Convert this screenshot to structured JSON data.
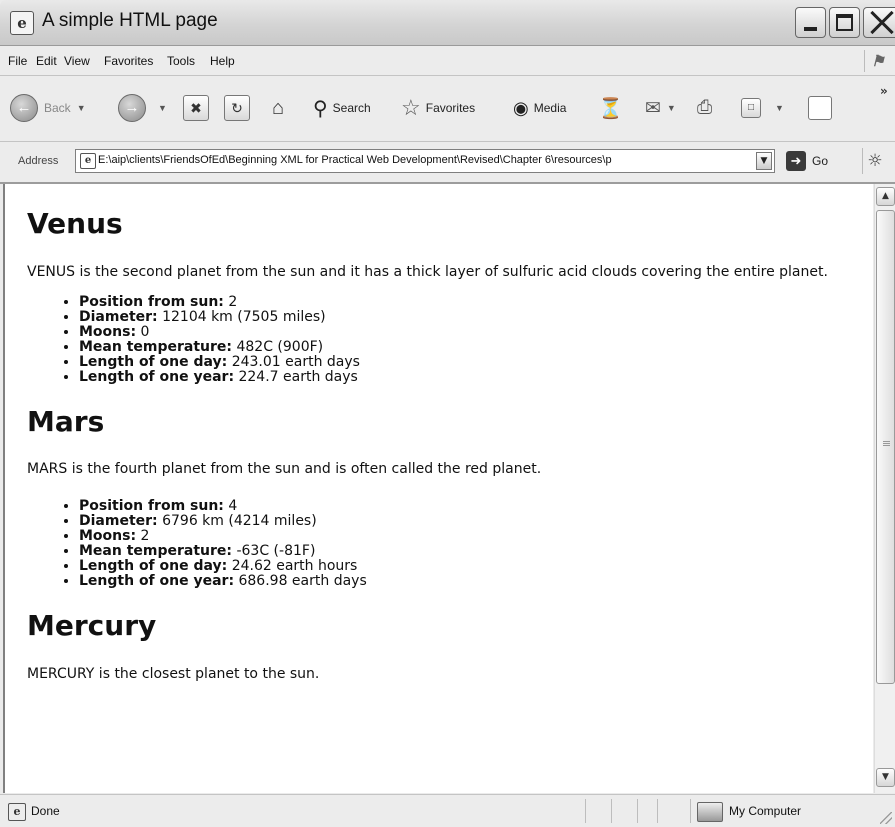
{
  "window": {
    "title": "A simple HTML page"
  },
  "menu": [
    "File",
    "Edit",
    "View",
    "Favorites",
    "Tools",
    "Help"
  ],
  "toolbar": {
    "back_label": "Back",
    "search_label": "Search",
    "favorites_label": "Favorites",
    "media_label": "Media"
  },
  "address": {
    "label": "Address",
    "value": "E:\\aip\\clients\\FriendsOfEd\\Beginning XML for Practical Web Development\\Revised\\Chapter 6\\resources\\p",
    "go_label": "Go"
  },
  "planets": [
    {
      "name": "Venus",
      "description": "VENUS is the second planet from the sun and it has a thick layer of sulfuric acid clouds covering the entire planet.",
      "facts": [
        {
          "label": "Position from sun:",
          "value": " 2"
        },
        {
          "label": "Diameter:",
          "value": " 12104 km (7505 miles)"
        },
        {
          "label": "Moons:",
          "value": " 0"
        },
        {
          "label": "Mean temperature:",
          "value": " 482C (900F)"
        },
        {
          "label": "Length of one day:",
          "value": " 243.01 earth days"
        },
        {
          "label": "Length of one year:",
          "value": " 224.7 earth days"
        }
      ]
    },
    {
      "name": "Mars",
      "description": "MARS is the fourth planet from the sun and is often called the red planet.",
      "facts": [
        {
          "label": "Position from sun:",
          "value": " 4"
        },
        {
          "label": "Diameter:",
          "value": " 6796 km (4214 miles)"
        },
        {
          "label": "Moons:",
          "value": " 2"
        },
        {
          "label": "Mean temperature:",
          "value": " -63C (-81F)"
        },
        {
          "label": "Length of one day:",
          "value": " 24.62 earth hours"
        },
        {
          "label": "Length of one year:",
          "value": " 686.98 earth days"
        }
      ]
    },
    {
      "name": "Mercury",
      "description": "MERCURY is the closest planet to the sun.",
      "facts": []
    }
  ],
  "status": {
    "text": "Done",
    "zone": "My Computer"
  }
}
